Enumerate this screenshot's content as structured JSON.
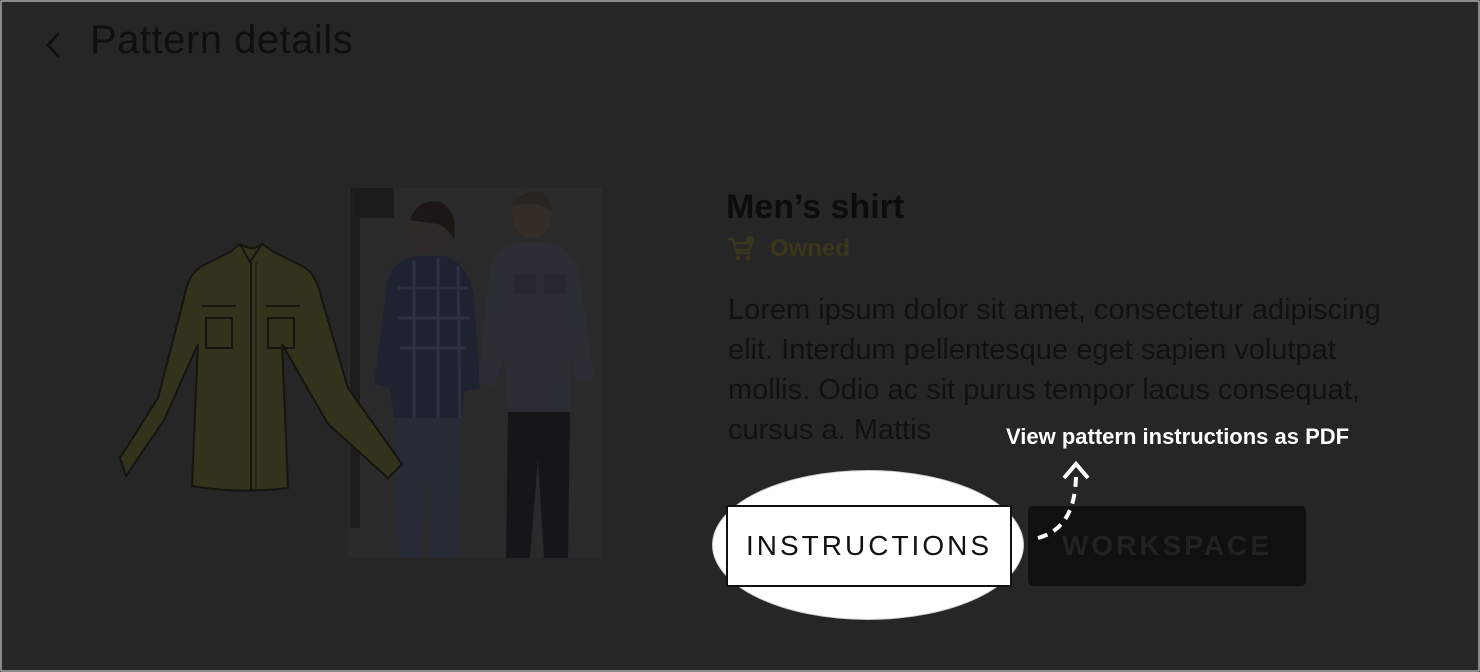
{
  "header": {
    "back_icon": "chevron-left-icon",
    "title": "Pattern details"
  },
  "product": {
    "name": "Men’s shirt",
    "status_icon": "cart-icon",
    "status_label": "Owned",
    "description": "Lorem ipsum dolor sit amet, consectetur adipiscing elit. Interdum pellentesque eget sapien volutpat mollis. Odio ac sit purus tempor lacus consequat, cursus a. Mattis",
    "image_alt": "Shirt illustration and models wearing the shirt"
  },
  "actions": {
    "instructions_label": "INSTRUCTIONS",
    "workspace_label": "WORKSPACE"
  },
  "tooltip": {
    "text": "View pattern instructions as PDF"
  },
  "colors": {
    "overlay": "#262626",
    "spotlight": "#ffffff",
    "owned_accent": "#3a3619"
  }
}
